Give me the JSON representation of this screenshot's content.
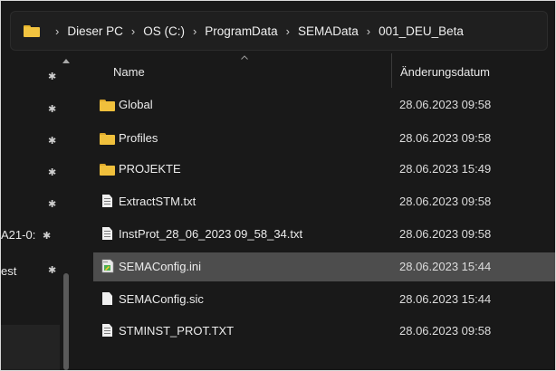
{
  "breadcrumb": {
    "items": [
      "Dieser PC",
      "OS (C:)",
      "ProgramData",
      "SEMAData",
      "001_DEU_Beta"
    ],
    "separator": "›"
  },
  "nav": {
    "truncated_labels": [
      "A21-0:",
      "est"
    ]
  },
  "columns": {
    "name": "Name",
    "date": "Änderungsdatum"
  },
  "files": [
    {
      "name": "Global",
      "date": "28.06.2023 09:58",
      "icon": "folder-icon"
    },
    {
      "name": "Profiles",
      "date": "28.06.2023 09:58",
      "icon": "folder-icon"
    },
    {
      "name": "PROJEKTE",
      "date": "28.06.2023 15:49",
      "icon": "folder-icon"
    },
    {
      "name": "ExtractSTM.txt",
      "date": "28.06.2023 09:58",
      "icon": "text-file-icon"
    },
    {
      "name": "InstProt_28_06_2023 09_58_34.txt",
      "date": "28.06.2023 09:58",
      "icon": "text-file-icon"
    },
    {
      "name": "SEMAConfig.ini",
      "date": "28.06.2023 15:44",
      "icon": "ini-file-icon",
      "selected": true
    },
    {
      "name": "SEMAConfig.sic",
      "date": "28.06.2023 15:44",
      "icon": "blank-file-icon"
    },
    {
      "name": "STMINST_PROT.TXT",
      "date": "28.06.2023 09:58",
      "icon": "text-file-icon"
    }
  ],
  "colors": {
    "background": "#191919",
    "selection": "#4d4d4d",
    "folder": "#f0c03c"
  }
}
